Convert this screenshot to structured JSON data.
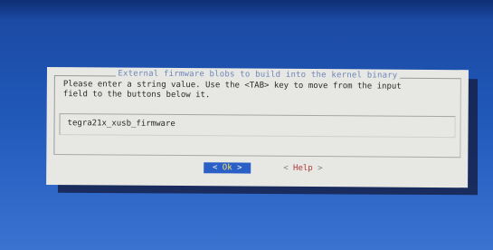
{
  "dialog": {
    "title": "External firmware blobs to build into the kernel binary",
    "prompt_line1": "Please enter a string value. Use the <TAB> key to move from the input",
    "prompt_line2": "field to the buttons below it.",
    "input_value": "tegra21x_xusb_firmware",
    "buttons": {
      "ok_left": "< ",
      "ok_label": "Ok",
      "ok_right": " >",
      "help_left": "< ",
      "help_label": "Help",
      "help_right": " >"
    }
  },
  "colors": {
    "background": "#1d4fa3",
    "dialog": "#e7e7e3",
    "title": "#6d86b8",
    "selected_button": "#2b5fc8",
    "help_text": "#b23a3a"
  }
}
